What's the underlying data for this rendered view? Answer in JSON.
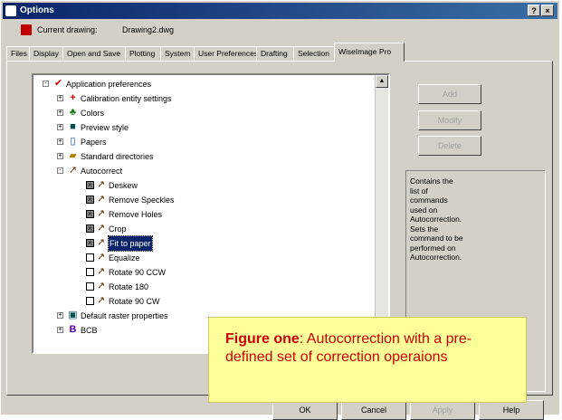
{
  "window": {
    "title": "Options",
    "help_label": "?",
    "close_label": "×"
  },
  "current_drawing": {
    "label": "Current drawing:",
    "value": "Drawing2.dwg"
  },
  "tabs": [
    {
      "label": "Files"
    },
    {
      "label": "Display"
    },
    {
      "label": "Open and Save"
    },
    {
      "label": "Plotting"
    },
    {
      "label": "System"
    },
    {
      "label": "User Preferences"
    },
    {
      "label": "Drafting"
    },
    {
      "label": "Selection"
    },
    {
      "label": "WiseImage Pro"
    }
  ],
  "tree": {
    "root": "Application preferences",
    "items": [
      "Calibration entity settings",
      "Colors",
      "Preview style",
      "Papers",
      "Standard directories",
      "Autocorrect",
      "Deskew",
      "Remove Speckles",
      "Remove Holes",
      "Crop",
      "Fit to paper",
      "Equalize",
      "Rotate 90 CCW",
      "Rotate 180",
      "Rotate 90 CW",
      "Default raster properties",
      "BCB"
    ]
  },
  "side_buttons": {
    "add": "Add",
    "modify": "Modify",
    "delete": "Delete"
  },
  "description": "Contains the list of commands used on Autocorrection. Sets the command to be performed on Autocorrection.",
  "bottom_buttons": {
    "ok": "OK",
    "cancel": "Cancel",
    "apply": "Apply",
    "help": "Help"
  },
  "callout": {
    "title": "Figure one",
    "text": ": Autocorrection with a pre-defined set of correction operaions"
  },
  "colors": {
    "title_bar": "#0a246a",
    "selection": "#0a246a",
    "callout_bg": "#ffff99",
    "callout_text": "#cc0000"
  }
}
